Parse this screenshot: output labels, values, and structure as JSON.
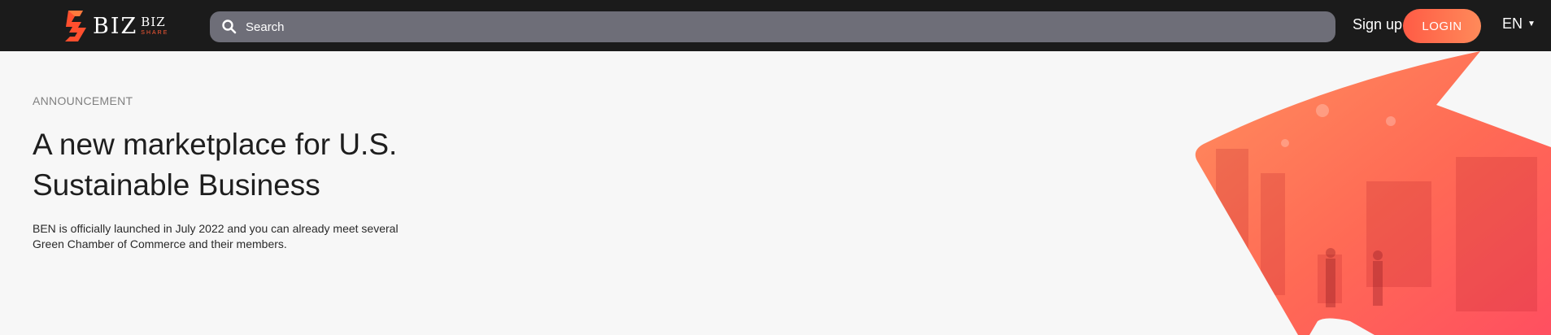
{
  "header": {
    "logo": {
      "main": "BIZ",
      "secondary": "BIZ",
      "tagline": "SHARE"
    },
    "search": {
      "placeholder": "Search"
    },
    "signup_label": "Sign up",
    "login_label": "LOGIN",
    "language": "EN"
  },
  "hero": {
    "eyebrow": "ANNOUNCEMENT",
    "title": "A new marketplace for U.S. Sustainable Business",
    "description": "BEN is officially launched in July 2022 and you can already meet several Green Chamber of Commerce and their members."
  },
  "colors": {
    "topbar": "#1b1b1b",
    "search_bg": "#6e6e78",
    "accent": "#ff5b45",
    "accent_light": "#ff8a5a",
    "page_bg": "#f7f7f7"
  },
  "icons": [
    "bizbiz-logo-icon",
    "search-icon",
    "caret-down-icon"
  ]
}
